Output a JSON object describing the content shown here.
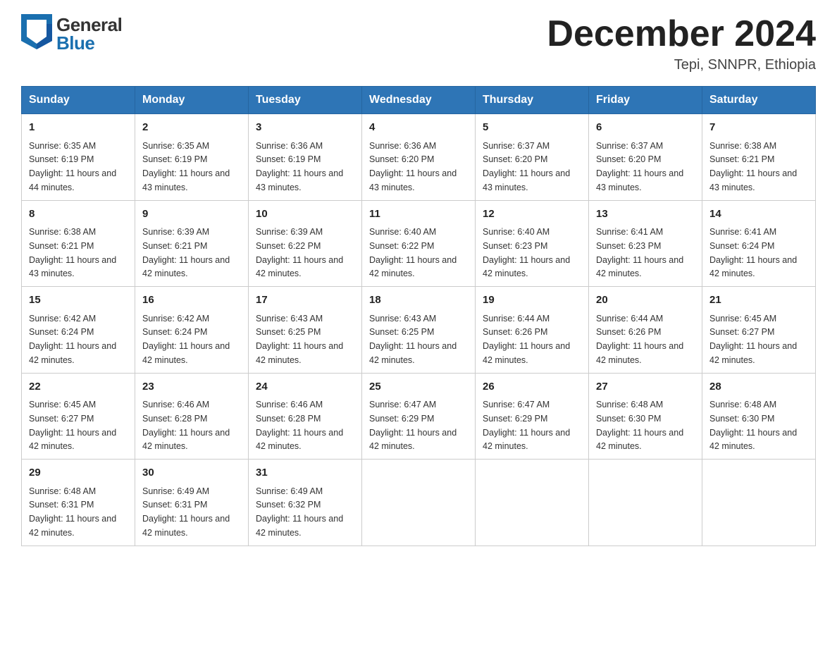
{
  "header": {
    "logo_general": "General",
    "logo_blue": "Blue",
    "month_title": "December 2024",
    "location": "Tepi, SNNPR, Ethiopia"
  },
  "weekdays": [
    "Sunday",
    "Monday",
    "Tuesday",
    "Wednesday",
    "Thursday",
    "Friday",
    "Saturday"
  ],
  "weeks": [
    [
      {
        "day": "1",
        "sunrise": "6:35 AM",
        "sunset": "6:19 PM",
        "daylight": "11 hours and 44 minutes."
      },
      {
        "day": "2",
        "sunrise": "6:35 AM",
        "sunset": "6:19 PM",
        "daylight": "11 hours and 43 minutes."
      },
      {
        "day": "3",
        "sunrise": "6:36 AM",
        "sunset": "6:19 PM",
        "daylight": "11 hours and 43 minutes."
      },
      {
        "day": "4",
        "sunrise": "6:36 AM",
        "sunset": "6:20 PM",
        "daylight": "11 hours and 43 minutes."
      },
      {
        "day": "5",
        "sunrise": "6:37 AM",
        "sunset": "6:20 PM",
        "daylight": "11 hours and 43 minutes."
      },
      {
        "day": "6",
        "sunrise": "6:37 AM",
        "sunset": "6:20 PM",
        "daylight": "11 hours and 43 minutes."
      },
      {
        "day": "7",
        "sunrise": "6:38 AM",
        "sunset": "6:21 PM",
        "daylight": "11 hours and 43 minutes."
      }
    ],
    [
      {
        "day": "8",
        "sunrise": "6:38 AM",
        "sunset": "6:21 PM",
        "daylight": "11 hours and 43 minutes."
      },
      {
        "day": "9",
        "sunrise": "6:39 AM",
        "sunset": "6:21 PM",
        "daylight": "11 hours and 42 minutes."
      },
      {
        "day": "10",
        "sunrise": "6:39 AM",
        "sunset": "6:22 PM",
        "daylight": "11 hours and 42 minutes."
      },
      {
        "day": "11",
        "sunrise": "6:40 AM",
        "sunset": "6:22 PM",
        "daylight": "11 hours and 42 minutes."
      },
      {
        "day": "12",
        "sunrise": "6:40 AM",
        "sunset": "6:23 PM",
        "daylight": "11 hours and 42 minutes."
      },
      {
        "day": "13",
        "sunrise": "6:41 AM",
        "sunset": "6:23 PM",
        "daylight": "11 hours and 42 minutes."
      },
      {
        "day": "14",
        "sunrise": "6:41 AM",
        "sunset": "6:24 PM",
        "daylight": "11 hours and 42 minutes."
      }
    ],
    [
      {
        "day": "15",
        "sunrise": "6:42 AM",
        "sunset": "6:24 PM",
        "daylight": "11 hours and 42 minutes."
      },
      {
        "day": "16",
        "sunrise": "6:42 AM",
        "sunset": "6:24 PM",
        "daylight": "11 hours and 42 minutes."
      },
      {
        "day": "17",
        "sunrise": "6:43 AM",
        "sunset": "6:25 PM",
        "daylight": "11 hours and 42 minutes."
      },
      {
        "day": "18",
        "sunrise": "6:43 AM",
        "sunset": "6:25 PM",
        "daylight": "11 hours and 42 minutes."
      },
      {
        "day": "19",
        "sunrise": "6:44 AM",
        "sunset": "6:26 PM",
        "daylight": "11 hours and 42 minutes."
      },
      {
        "day": "20",
        "sunrise": "6:44 AM",
        "sunset": "6:26 PM",
        "daylight": "11 hours and 42 minutes."
      },
      {
        "day": "21",
        "sunrise": "6:45 AM",
        "sunset": "6:27 PM",
        "daylight": "11 hours and 42 minutes."
      }
    ],
    [
      {
        "day": "22",
        "sunrise": "6:45 AM",
        "sunset": "6:27 PM",
        "daylight": "11 hours and 42 minutes."
      },
      {
        "day": "23",
        "sunrise": "6:46 AM",
        "sunset": "6:28 PM",
        "daylight": "11 hours and 42 minutes."
      },
      {
        "day": "24",
        "sunrise": "6:46 AM",
        "sunset": "6:28 PM",
        "daylight": "11 hours and 42 minutes."
      },
      {
        "day": "25",
        "sunrise": "6:47 AM",
        "sunset": "6:29 PM",
        "daylight": "11 hours and 42 minutes."
      },
      {
        "day": "26",
        "sunrise": "6:47 AM",
        "sunset": "6:29 PM",
        "daylight": "11 hours and 42 minutes."
      },
      {
        "day": "27",
        "sunrise": "6:48 AM",
        "sunset": "6:30 PM",
        "daylight": "11 hours and 42 minutes."
      },
      {
        "day": "28",
        "sunrise": "6:48 AM",
        "sunset": "6:30 PM",
        "daylight": "11 hours and 42 minutes."
      }
    ],
    [
      {
        "day": "29",
        "sunrise": "6:48 AM",
        "sunset": "6:31 PM",
        "daylight": "11 hours and 42 minutes."
      },
      {
        "day": "30",
        "sunrise": "6:49 AM",
        "sunset": "6:31 PM",
        "daylight": "11 hours and 42 minutes."
      },
      {
        "day": "31",
        "sunrise": "6:49 AM",
        "sunset": "6:32 PM",
        "daylight": "11 hours and 42 minutes."
      },
      null,
      null,
      null,
      null
    ]
  ]
}
